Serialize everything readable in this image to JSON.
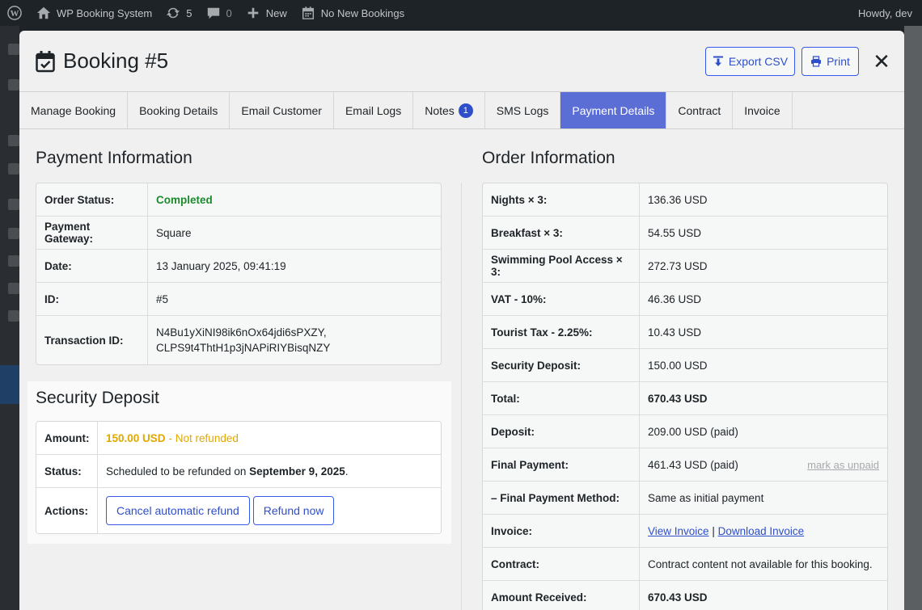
{
  "adminbar": {
    "site_name": "WP Booking System",
    "updates_count": "5",
    "comments_count": "0",
    "new_label": "New",
    "bookings_label": "No New Bookings",
    "greeting": "Howdy, dev"
  },
  "modal": {
    "title": "Booking #5",
    "export_label": "Export CSV",
    "print_label": "Print",
    "close_label": "✕"
  },
  "tabs": [
    {
      "label": "Manage Booking"
    },
    {
      "label": "Booking Details"
    },
    {
      "label": "Email Customer"
    },
    {
      "label": "Email Logs"
    },
    {
      "label": "Notes",
      "badge": "1"
    },
    {
      "label": "SMS Logs"
    },
    {
      "label": "Payment Details",
      "active": true
    },
    {
      "label": "Contract"
    },
    {
      "label": "Invoice"
    }
  ],
  "payment": {
    "title": "Payment Information",
    "rows": [
      {
        "key": "Order Status:",
        "value": "Completed"
      },
      {
        "key": "Payment Gateway:",
        "value": "Square"
      },
      {
        "key": "Date:",
        "value": "13 January 2025, 09:41:19"
      },
      {
        "key": "ID:",
        "value": "#5"
      },
      {
        "key": "Transaction ID:",
        "value_line1": "N4Bu1yXiNI98ik6nOx64jdi6sPXZY,",
        "value_line2": "CLPS9t4ThtH1p3jNAPiRIYBisqNZY"
      }
    ]
  },
  "deposit": {
    "title": "Security Deposit",
    "amount_key": "Amount:",
    "amount_value": "150.00 USD",
    "amount_note": "- Not refunded",
    "status_key": "Status:",
    "status_text": "Scheduled to be refunded on",
    "status_date": "September 9, 2025",
    "status_end": ".",
    "actions_key": "Actions:",
    "cancel_label": "Cancel automatic refund",
    "refund_label": "Refund now"
  },
  "order": {
    "title": "Order Information",
    "rows": [
      {
        "key": "Nights × 3:",
        "value": "136.36 USD"
      },
      {
        "key": "Breakfast × 3:",
        "value": "54.55 USD"
      },
      {
        "key": "Swimming Pool Access × 3:",
        "value": "272.73 USD"
      },
      {
        "key": "VAT - 10%:",
        "value": "46.36 USD"
      },
      {
        "key": "Tourist Tax - 2.25%:",
        "value": "10.43 USD"
      },
      {
        "key": "Security Deposit:",
        "value": "150.00 USD"
      },
      {
        "key": "Total:",
        "value": "670.43 USD"
      },
      {
        "key": "Deposit:",
        "value": "209.00 USD (paid)"
      },
      {
        "key": "Final Payment:",
        "value": "461.43 USD (paid)",
        "action": "mark as unpaid"
      },
      {
        "key": "– Final Payment Method:",
        "value": "Same as initial payment"
      },
      {
        "key": "Invoice:",
        "link1": "View Invoice",
        "sep": "|",
        "link2": "Download Invoice"
      },
      {
        "key": "Contract:",
        "value": "Contract content not available for this booking."
      },
      {
        "key": "Amount Received:",
        "value": "670.43 USD"
      }
    ]
  }
}
